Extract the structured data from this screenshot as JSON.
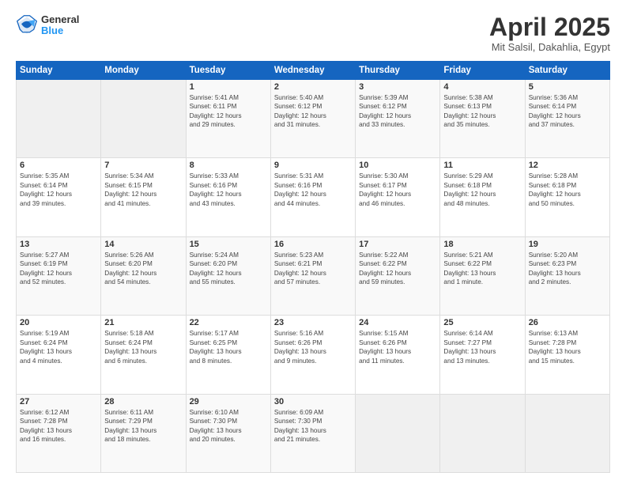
{
  "header": {
    "logo": {
      "general": "General",
      "blue": "Blue"
    },
    "title": "April 2025",
    "location": "Mit Salsil, Dakahlia, Egypt"
  },
  "days_of_week": [
    "Sunday",
    "Monday",
    "Tuesday",
    "Wednesday",
    "Thursday",
    "Friday",
    "Saturday"
  ],
  "weeks": [
    [
      {
        "num": "",
        "info": ""
      },
      {
        "num": "",
        "info": ""
      },
      {
        "num": "1",
        "info": "Sunrise: 5:41 AM\nSunset: 6:11 PM\nDaylight: 12 hours\nand 29 minutes."
      },
      {
        "num": "2",
        "info": "Sunrise: 5:40 AM\nSunset: 6:12 PM\nDaylight: 12 hours\nand 31 minutes."
      },
      {
        "num": "3",
        "info": "Sunrise: 5:39 AM\nSunset: 6:12 PM\nDaylight: 12 hours\nand 33 minutes."
      },
      {
        "num": "4",
        "info": "Sunrise: 5:38 AM\nSunset: 6:13 PM\nDaylight: 12 hours\nand 35 minutes."
      },
      {
        "num": "5",
        "info": "Sunrise: 5:36 AM\nSunset: 6:14 PM\nDaylight: 12 hours\nand 37 minutes."
      }
    ],
    [
      {
        "num": "6",
        "info": "Sunrise: 5:35 AM\nSunset: 6:14 PM\nDaylight: 12 hours\nand 39 minutes."
      },
      {
        "num": "7",
        "info": "Sunrise: 5:34 AM\nSunset: 6:15 PM\nDaylight: 12 hours\nand 41 minutes."
      },
      {
        "num": "8",
        "info": "Sunrise: 5:33 AM\nSunset: 6:16 PM\nDaylight: 12 hours\nand 43 minutes."
      },
      {
        "num": "9",
        "info": "Sunrise: 5:31 AM\nSunset: 6:16 PM\nDaylight: 12 hours\nand 44 minutes."
      },
      {
        "num": "10",
        "info": "Sunrise: 5:30 AM\nSunset: 6:17 PM\nDaylight: 12 hours\nand 46 minutes."
      },
      {
        "num": "11",
        "info": "Sunrise: 5:29 AM\nSunset: 6:18 PM\nDaylight: 12 hours\nand 48 minutes."
      },
      {
        "num": "12",
        "info": "Sunrise: 5:28 AM\nSunset: 6:18 PM\nDaylight: 12 hours\nand 50 minutes."
      }
    ],
    [
      {
        "num": "13",
        "info": "Sunrise: 5:27 AM\nSunset: 6:19 PM\nDaylight: 12 hours\nand 52 minutes."
      },
      {
        "num": "14",
        "info": "Sunrise: 5:26 AM\nSunset: 6:20 PM\nDaylight: 12 hours\nand 54 minutes."
      },
      {
        "num": "15",
        "info": "Sunrise: 5:24 AM\nSunset: 6:20 PM\nDaylight: 12 hours\nand 55 minutes."
      },
      {
        "num": "16",
        "info": "Sunrise: 5:23 AM\nSunset: 6:21 PM\nDaylight: 12 hours\nand 57 minutes."
      },
      {
        "num": "17",
        "info": "Sunrise: 5:22 AM\nSunset: 6:22 PM\nDaylight: 12 hours\nand 59 minutes."
      },
      {
        "num": "18",
        "info": "Sunrise: 5:21 AM\nSunset: 6:22 PM\nDaylight: 13 hours\nand 1 minute."
      },
      {
        "num": "19",
        "info": "Sunrise: 5:20 AM\nSunset: 6:23 PM\nDaylight: 13 hours\nand 2 minutes."
      }
    ],
    [
      {
        "num": "20",
        "info": "Sunrise: 5:19 AM\nSunset: 6:24 PM\nDaylight: 13 hours\nand 4 minutes."
      },
      {
        "num": "21",
        "info": "Sunrise: 5:18 AM\nSunset: 6:24 PM\nDaylight: 13 hours\nand 6 minutes."
      },
      {
        "num": "22",
        "info": "Sunrise: 5:17 AM\nSunset: 6:25 PM\nDaylight: 13 hours\nand 8 minutes."
      },
      {
        "num": "23",
        "info": "Sunrise: 5:16 AM\nSunset: 6:26 PM\nDaylight: 13 hours\nand 9 minutes."
      },
      {
        "num": "24",
        "info": "Sunrise: 5:15 AM\nSunset: 6:26 PM\nDaylight: 13 hours\nand 11 minutes."
      },
      {
        "num": "25",
        "info": "Sunrise: 6:14 AM\nSunset: 7:27 PM\nDaylight: 13 hours\nand 13 minutes."
      },
      {
        "num": "26",
        "info": "Sunrise: 6:13 AM\nSunset: 7:28 PM\nDaylight: 13 hours\nand 15 minutes."
      }
    ],
    [
      {
        "num": "27",
        "info": "Sunrise: 6:12 AM\nSunset: 7:28 PM\nDaylight: 13 hours\nand 16 minutes."
      },
      {
        "num": "28",
        "info": "Sunrise: 6:11 AM\nSunset: 7:29 PM\nDaylight: 13 hours\nand 18 minutes."
      },
      {
        "num": "29",
        "info": "Sunrise: 6:10 AM\nSunset: 7:30 PM\nDaylight: 13 hours\nand 20 minutes."
      },
      {
        "num": "30",
        "info": "Sunrise: 6:09 AM\nSunset: 7:30 PM\nDaylight: 13 hours\nand 21 minutes."
      },
      {
        "num": "",
        "info": ""
      },
      {
        "num": "",
        "info": ""
      },
      {
        "num": "",
        "info": ""
      }
    ]
  ]
}
